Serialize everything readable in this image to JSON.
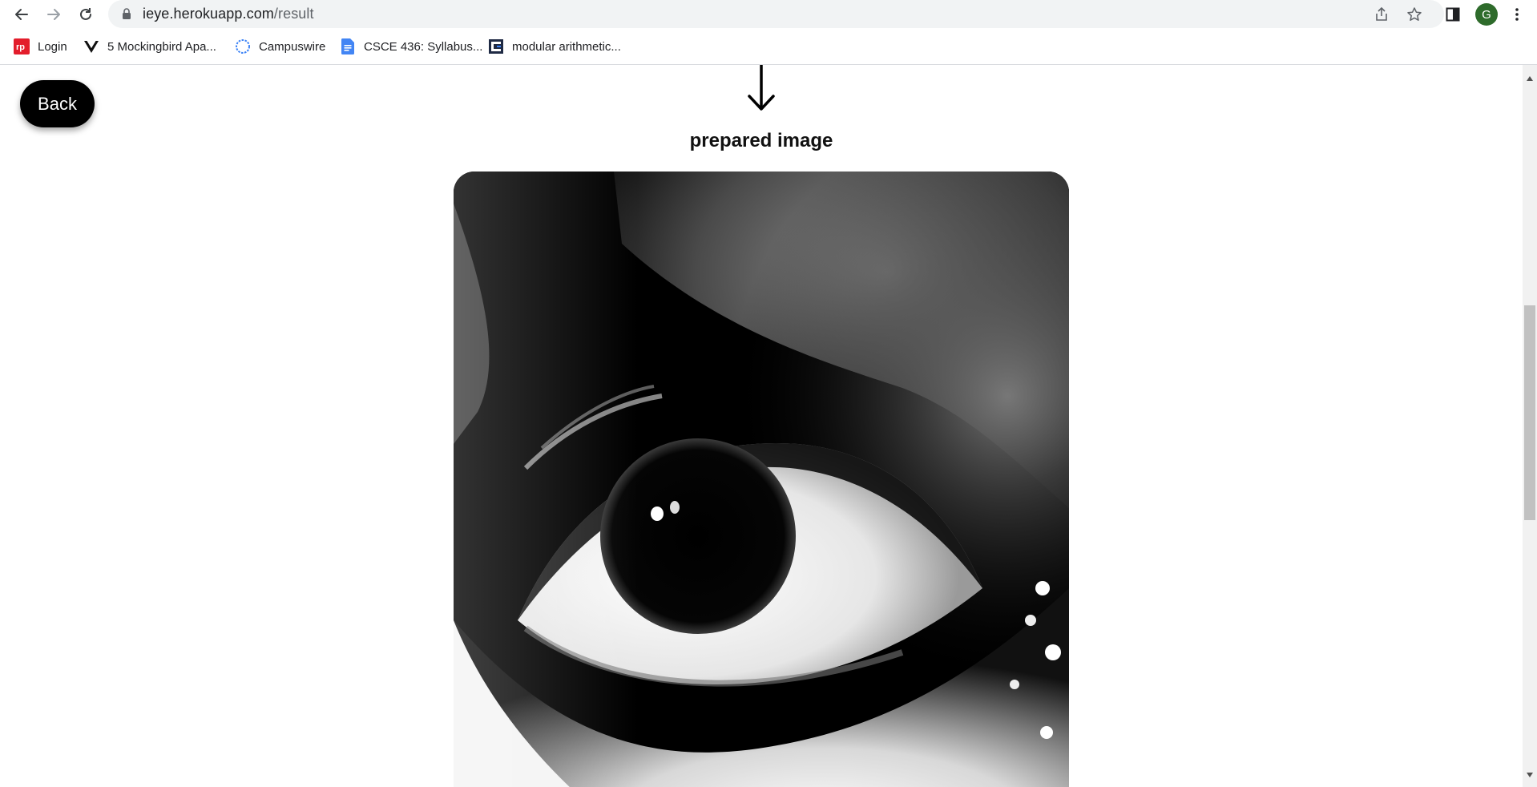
{
  "browser": {
    "url_host": "ieye.herokuapp.com",
    "url_path": "/result",
    "profile_initial": "G",
    "bookmarks": [
      {
        "label": "Login",
        "icon": "rp-logo-icon"
      },
      {
        "label": "5 Mockingbird Apa...",
        "icon": "v-logo-icon"
      },
      {
        "label": "Campuswire",
        "icon": "campuswire-icon"
      },
      {
        "label": "CSCE 436: Syllabus...",
        "icon": "google-docs-icon"
      },
      {
        "label": "modular arithmetic...",
        "icon": "c-logo-icon"
      }
    ],
    "colors": {
      "avatar": "#2e6b2b",
      "omnibox": "#f1f3f4"
    }
  },
  "page": {
    "back_label": "Back",
    "arrow_icon": "down-arrow-icon",
    "section_title": "prepared image"
  }
}
